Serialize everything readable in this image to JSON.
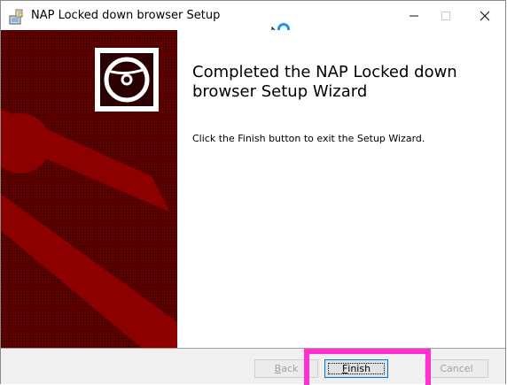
{
  "window": {
    "title": "NAP Locked down browser Setup"
  },
  "content": {
    "heading": "Completed the NAP Locked down browser Setup Wizard",
    "message": "Click the Finish button to exit the Setup Wizard."
  },
  "footer": {
    "back_prefix": "",
    "back_mnemonic": "B",
    "back_rest": "ack",
    "finish_mnemonic": "F",
    "finish_rest": "inish",
    "cancel_label": "Cancel"
  },
  "colors": {
    "banner": "#6b0000",
    "highlight": "#ff2fd0",
    "focus_border": "#0078d7"
  },
  "icons": [
    "installer-app-icon",
    "minimize-icon",
    "maximize-icon",
    "close-icon",
    "cd-disc-icon",
    "mouse-cursor-icon"
  ]
}
